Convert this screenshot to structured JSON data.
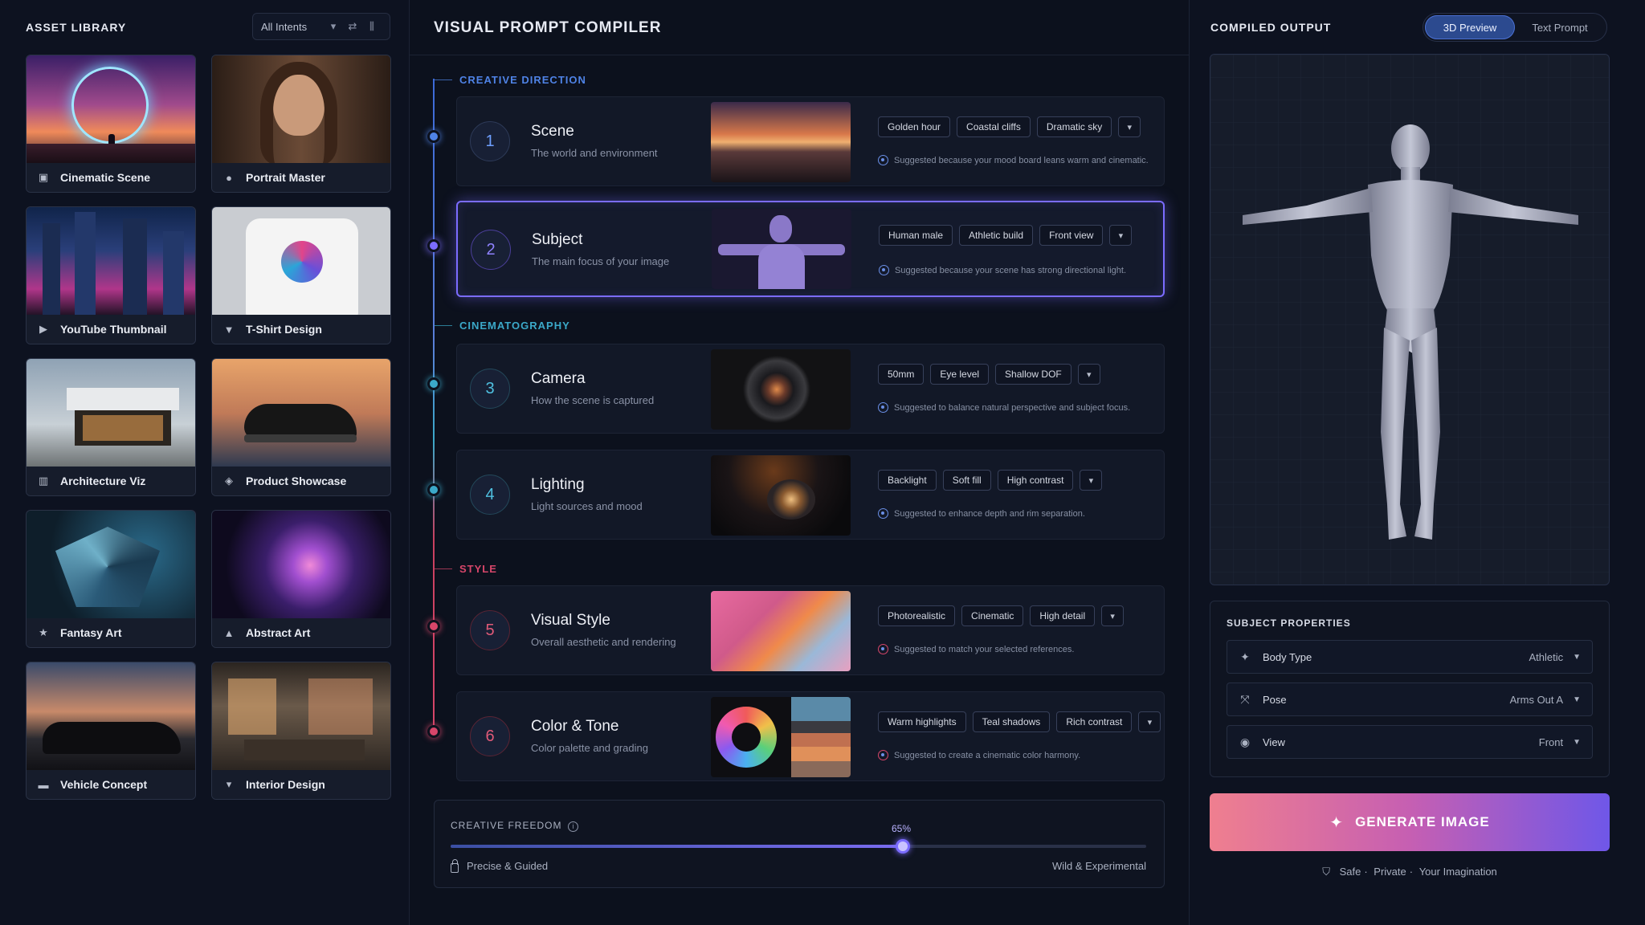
{
  "left": {
    "title": "ASSET LIBRARY",
    "filter": "All Intents",
    "cards": [
      {
        "label": "Cinematic Scene",
        "icon": "film-icon"
      },
      {
        "label": "Portrait Master",
        "icon": "person-icon"
      },
      {
        "label": "YouTube Thumbnail",
        "icon": "play-icon"
      },
      {
        "label": "T-Shirt Design",
        "icon": "shirt-icon"
      },
      {
        "label": "Architecture Viz",
        "icon": "building-icon"
      },
      {
        "label": "Product Showcase",
        "icon": "box-icon"
      },
      {
        "label": "Fantasy Art",
        "icon": "star-icon"
      },
      {
        "label": "Abstract Art",
        "icon": "shapes-icon"
      },
      {
        "label": "Vehicle Concept",
        "icon": "car-icon"
      },
      {
        "label": "Interior Design",
        "icon": "lamp-icon"
      }
    ]
  },
  "center": {
    "title": "VISUAL PROMPT COMPILER",
    "sections": {
      "creative": "CREATIVE DIRECTION",
      "cinema": "CINEMATOGRAPHY",
      "style": "STYLE"
    },
    "steps": [
      {
        "num": "1",
        "title": "Scene",
        "sub": "The world and environment",
        "chips": [
          "Golden hour",
          "Coastal cliffs",
          "Dramatic sky"
        ],
        "suggestion": "Suggested because your mood board leans warm and cinematic."
      },
      {
        "num": "2",
        "title": "Subject",
        "sub": "The main focus of your image",
        "chips": [
          "Human male",
          "Athletic build",
          "Front view"
        ],
        "suggestion": "Suggested because your scene has strong directional light."
      },
      {
        "num": "3",
        "title": "Camera",
        "sub": "How the scene is captured",
        "chips": [
          "50mm",
          "Eye level",
          "Shallow DOF"
        ],
        "suggestion": "Suggested to balance natural perspective and subject focus."
      },
      {
        "num": "4",
        "title": "Lighting",
        "sub": "Light sources and mood",
        "chips": [
          "Backlight",
          "Soft fill",
          "High contrast"
        ],
        "suggestion": "Suggested to enhance depth and rim separation."
      },
      {
        "num": "5",
        "title": "Visual Style",
        "sub": "Overall aesthetic and rendering",
        "chips": [
          "Photorealistic",
          "Cinematic",
          "High detail"
        ],
        "suggestion": "Suggested to match your selected references."
      },
      {
        "num": "6",
        "title": "Color & Tone",
        "sub": "Color palette and grading",
        "chips": [
          "Warm highlights",
          "Teal shadows",
          "Rich contrast"
        ],
        "suggestion": "Suggested to create a cinematic color harmony."
      }
    ],
    "freedom": {
      "label": "CREATIVE FREEDOM",
      "value": "65%",
      "value_fraction": 0.65,
      "low": "Precise & Guided",
      "high": "Wild & Experimental"
    }
  },
  "right": {
    "title": "COMPILED OUTPUT",
    "tabs": [
      "3D Preview",
      "Text Prompt"
    ],
    "props": {
      "title": "SUBJECT PROPERTIES",
      "rows": [
        {
          "name": "Body Type",
          "value": "Athletic"
        },
        {
          "name": "Pose",
          "value": "Arms Out A"
        },
        {
          "name": "View",
          "value": "Front"
        }
      ]
    },
    "generate": "GENERATE IMAGE",
    "footer": [
      "Safe",
      "Private",
      "Your Imagination"
    ]
  },
  "colors": {
    "accent": "#7b6cff",
    "creative": "#4f83e6",
    "cinema": "#3ba9c9",
    "style": "#d7466a"
  }
}
